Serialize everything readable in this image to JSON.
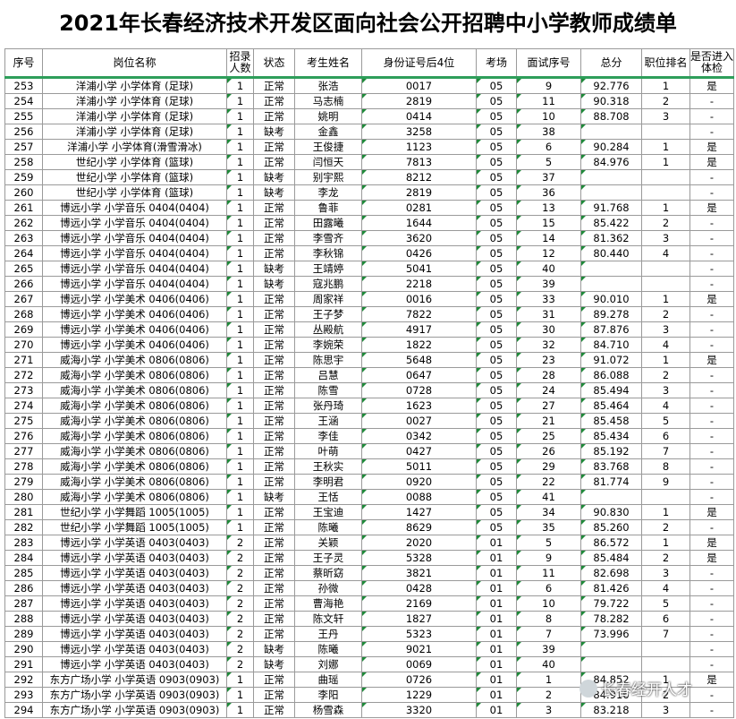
{
  "title": "2021年长春经济技术开发区面向社会公开招聘中小学教师成绩单",
  "columns": [
    "序号",
    "岗位名称",
    "招录人数",
    "状态",
    "考生姓名",
    "身份证号后4位",
    "考场",
    "面试序号",
    "总分",
    "职位排名",
    "是否进入体检"
  ],
  "rows": [
    [
      "253",
      "洋浦小学 小学体育 (足球)",
      "1",
      "正常",
      "张浩",
      "0017",
      "05",
      "9",
      "92.776",
      "1",
      "是"
    ],
    [
      "254",
      "洋浦小学 小学体育 (足球)",
      "1",
      "正常",
      "马志楠",
      "2819",
      "05",
      "11",
      "90.318",
      "2",
      "-"
    ],
    [
      "255",
      "洋浦小学 小学体育 (足球)",
      "1",
      "正常",
      "姚明",
      "0414",
      "05",
      "10",
      "88.708",
      "3",
      "-"
    ],
    [
      "256",
      "洋浦小学 小学体育 (足球)",
      "1",
      "缺考",
      "金鑫",
      "3258",
      "05",
      "38",
      "",
      "",
      "-"
    ],
    [
      "257",
      "洋浦小学 小学体育(滑雪滑冰)",
      "1",
      "正常",
      "王俊捷",
      "1123",
      "05",
      "6",
      "90.284",
      "1",
      "是"
    ],
    [
      "258",
      "世纪小学 小学体育 (篮球)",
      "1",
      "正常",
      "闫恒天",
      "7813",
      "05",
      "5",
      "84.976",
      "1",
      "是"
    ],
    [
      "259",
      "世纪小学 小学体育 (篮球)",
      "1",
      "缺考",
      "别宇熙",
      "8212",
      "05",
      "37",
      "",
      "",
      "-"
    ],
    [
      "260",
      "世纪小学 小学体育 (篮球)",
      "1",
      "缺考",
      "李龙",
      "2819",
      "05",
      "36",
      "",
      "",
      "-"
    ],
    [
      "261",
      "博远小学 小学音乐 0404(0404)",
      "1",
      "正常",
      "鲁菲",
      "0281",
      "05",
      "13",
      "91.768",
      "1",
      "是"
    ],
    [
      "262",
      "博远小学 小学音乐 0404(0404)",
      "1",
      "正常",
      "田露曦",
      "1644",
      "05",
      "15",
      "85.422",
      "2",
      "-"
    ],
    [
      "263",
      "博远小学 小学音乐 0404(0404)",
      "1",
      "正常",
      "李雪齐",
      "3620",
      "05",
      "14",
      "81.362",
      "3",
      "-"
    ],
    [
      "264",
      "博远小学 小学音乐 0404(0404)",
      "1",
      "正常",
      "李秋锦",
      "0426",
      "05",
      "12",
      "80.440",
      "4",
      "-"
    ],
    [
      "265",
      "博远小学 小学音乐 0404(0404)",
      "1",
      "缺考",
      "王靖婷",
      "5041",
      "05",
      "40",
      "",
      "",
      "-"
    ],
    [
      "266",
      "博远小学 小学音乐 0404(0404)",
      "1",
      "缺考",
      "寇兆鹏",
      "2218",
      "05",
      "39",
      "",
      "",
      "-"
    ],
    [
      "267",
      "博远小学 小学美术 0406(0406)",
      "1",
      "正常",
      "周家祥",
      "0016",
      "05",
      "33",
      "90.010",
      "1",
      "是"
    ],
    [
      "268",
      "博远小学 小学美术 0406(0406)",
      "1",
      "正常",
      "王子梦",
      "7822",
      "05",
      "31",
      "89.278",
      "2",
      "-"
    ],
    [
      "269",
      "博远小学 小学美术 0406(0406)",
      "1",
      "正常",
      "丛殿航",
      "4917",
      "05",
      "30",
      "87.876",
      "3",
      "-"
    ],
    [
      "270",
      "博远小学 小学美术 0406(0406)",
      "1",
      "正常",
      "李婉荣",
      "1822",
      "05",
      "32",
      "84.710",
      "4",
      "-"
    ],
    [
      "271",
      "威海小学 小学美术 0806(0806)",
      "1",
      "正常",
      "陈思宇",
      "5648",
      "05",
      "23",
      "91.072",
      "1",
      "是"
    ],
    [
      "272",
      "威海小学 小学美术 0806(0806)",
      "1",
      "正常",
      "吕慧",
      "0647",
      "05",
      "28",
      "86.088",
      "2",
      "-"
    ],
    [
      "273",
      "威海小学 小学美术 0806(0806)",
      "1",
      "正常",
      "陈雪",
      "0728",
      "05",
      "24",
      "85.494",
      "3",
      "-"
    ],
    [
      "274",
      "威海小学 小学美术 0806(0806)",
      "1",
      "正常",
      "张丹琦",
      "1623",
      "05",
      "27",
      "85.464",
      "4",
      "-"
    ],
    [
      "275",
      "威海小学 小学美术 0806(0806)",
      "1",
      "正常",
      "王涵",
      "0027",
      "05",
      "21",
      "85.458",
      "5",
      "-"
    ],
    [
      "276",
      "威海小学 小学美术 0806(0806)",
      "1",
      "正常",
      "李佳",
      "0342",
      "05",
      "25",
      "85.434",
      "6",
      "-"
    ],
    [
      "277",
      "威海小学 小学美术 0806(0806)",
      "1",
      "正常",
      "叶萌",
      "0427",
      "05",
      "26",
      "85.192",
      "7",
      "-"
    ],
    [
      "278",
      "威海小学 小学美术 0806(0806)",
      "1",
      "正常",
      "王秋实",
      "5011",
      "05",
      "29",
      "83.768",
      "8",
      "-"
    ],
    [
      "279",
      "威海小学 小学美术 0806(0806)",
      "1",
      "正常",
      "李明君",
      "0920",
      "05",
      "22",
      "81.774",
      "9",
      "-"
    ],
    [
      "280",
      "威海小学 小学美术 0806(0806)",
      "1",
      "缺考",
      "王恬",
      "0088",
      "05",
      "41",
      "",
      "",
      "-"
    ],
    [
      "281",
      "世纪小学 小学舞蹈 1005(1005)",
      "1",
      "正常",
      "王宝迪",
      "1427",
      "05",
      "34",
      "90.830",
      "1",
      "是"
    ],
    [
      "282",
      "世纪小学 小学舞蹈 1005(1005)",
      "1",
      "正常",
      "陈曦",
      "8629",
      "05",
      "35",
      "85.260",
      "2",
      "-"
    ],
    [
      "283",
      "博远小学 小学英语 0403(0403)",
      "2",
      "正常",
      "关颖",
      "2020",
      "01",
      "5",
      "86.572",
      "1",
      "是"
    ],
    [
      "284",
      "博远小学 小学英语 0403(0403)",
      "2",
      "正常",
      "王子灵",
      "5328",
      "01",
      "9",
      "85.484",
      "2",
      "是"
    ],
    [
      "285",
      "博远小学 小学英语 0403(0403)",
      "2",
      "正常",
      "蔡昕窈",
      "3821",
      "01",
      "11",
      "82.698",
      "3",
      "-"
    ],
    [
      "286",
      "博远小学 小学英语 0403(0403)",
      "2",
      "正常",
      "孙微",
      "0428",
      "01",
      "6",
      "81.426",
      "4",
      "-"
    ],
    [
      "287",
      "博远小学 小学英语 0403(0403)",
      "2",
      "正常",
      "曹海艳",
      "2169",
      "01",
      "10",
      "79.722",
      "5",
      "-"
    ],
    [
      "288",
      "博远小学 小学英语 0403(0403)",
      "2",
      "正常",
      "陈文轩",
      "1827",
      "01",
      "8",
      "78.282",
      "6",
      "-"
    ],
    [
      "289",
      "博远小学 小学英语 0403(0403)",
      "2",
      "正常",
      "王丹",
      "5323",
      "01",
      "7",
      "73.996",
      "7",
      "-"
    ],
    [
      "290",
      "博远小学 小学英语 0403(0403)",
      "2",
      "缺考",
      "陈曦",
      "9021",
      "01",
      "39",
      "",
      "",
      "-"
    ],
    [
      "291",
      "博远小学 小学英语 0403(0403)",
      "2",
      "缺考",
      "刘娜",
      "0069",
      "01",
      "40",
      "",
      "",
      "-"
    ],
    [
      "292",
      "东方广场小学 小学英语 0903(0903)",
      "1",
      "正常",
      "曲瑶",
      "0726",
      "01",
      "1",
      "84.852",
      "1",
      "是"
    ],
    [
      "293",
      "东方广场小学 小学英语 0903(0903)",
      "1",
      "正常",
      "李阳",
      "1229",
      "01",
      "2",
      "84.916",
      "2",
      "-"
    ],
    [
      "294",
      "东方广场小学 小学英语 0903(0903)",
      "1",
      "正常",
      "杨雪森",
      "3320",
      "01",
      "3",
      "83.218",
      "3",
      "-"
    ]
  ],
  "watermark": "长春经开人才",
  "colors": {
    "header_rule": "#2e9e5a",
    "cell_marker": "#1f8a3a",
    "grid": "#9a9a9a"
  }
}
